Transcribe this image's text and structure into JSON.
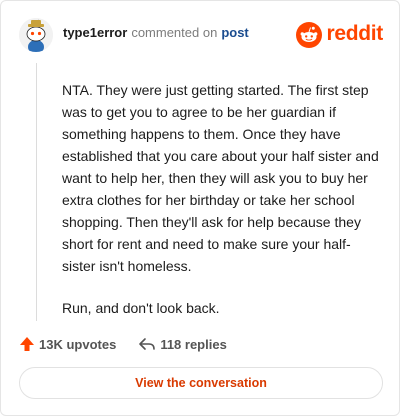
{
  "header": {
    "username": "type1error",
    "action_text": "commented on",
    "link_text": "post",
    "brand_text": "reddit",
    "avatar_icon": "snoo-avatar-icon",
    "brand_icon": "reddit-snoo-icon"
  },
  "comment": {
    "paragraphs": [
      "NTA. They were just getting started. The first step was to get you to agree to be her guardian if something happens to them. Once they have established that you care about your half sister and want to help her, then they will ask you to buy her extra clothes for her birthday or take her school shopping. Then they'll ask for help because they short for rent and need to make sure your half-sister isn't homeless.",
      "Run, and don't look back."
    ]
  },
  "stats": {
    "upvotes": "13K upvotes",
    "replies": "118 replies",
    "upvote_icon": "upvote-arrow-icon",
    "reply_icon": "reply-arrow-icon"
  },
  "cta": {
    "label": "View the conversation"
  },
  "colors": {
    "brand_orange": "#ff4500",
    "link_blue": "#1a4c8f",
    "cta_text": "#d93a00",
    "upvote": "#ff4500"
  }
}
